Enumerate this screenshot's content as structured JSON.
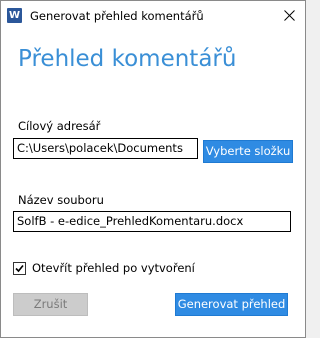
{
  "window": {
    "title": "Generovat přehled komentářů",
    "app_icon_letter": "W"
  },
  "main": {
    "heading": "Přehled komentářů"
  },
  "target_dir": {
    "label": "Cílový adresář",
    "value": "C:\\Users\\polacek\\Documents",
    "browse_label": "Vyberte složku"
  },
  "file_name": {
    "label": "Název souboru",
    "value": "SolfB - e-edice_PrehledKomentaru.docx"
  },
  "open_after": {
    "label": "Otevřít přehled po vytvoření",
    "checked": true
  },
  "buttons": {
    "cancel_label": "Zrušit",
    "generate_label": "Generovat přehled"
  }
}
